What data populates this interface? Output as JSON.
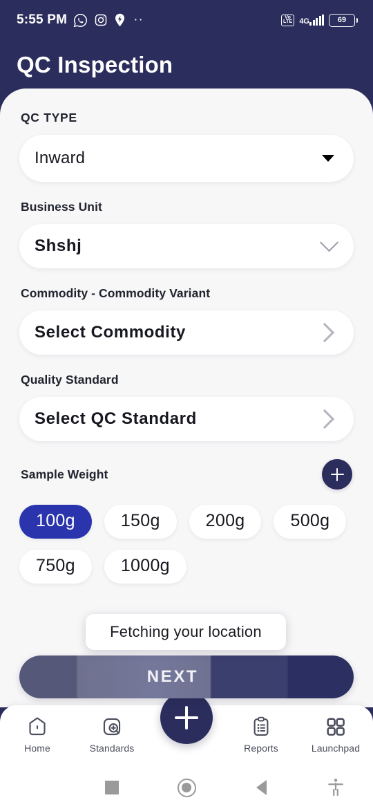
{
  "status_bar": {
    "time": "5:55 PM",
    "icons": [
      "whatsapp-icon",
      "instagram-icon",
      "location-pin-icon"
    ],
    "more_indicator": "··",
    "volte_top": "Vo",
    "volte_bottom": "LTE",
    "network": "4G",
    "battery_percent": "69"
  },
  "header": {
    "title": "QC Inspection",
    "background_color": "#2b2d5c"
  },
  "form": {
    "qc_type": {
      "label": "QC TYPE",
      "value": "Inward",
      "icon": "caret-down-icon"
    },
    "business_unit": {
      "label": "Business Unit",
      "value": "Shshj",
      "icon": "chevron-down-icon"
    },
    "commodity": {
      "label": "Commodity - Commodity Variant",
      "value": "Select Commodity",
      "icon": "chevron-right-icon"
    },
    "quality_standard": {
      "label": "Quality Standard",
      "value": "Select QC Standard",
      "icon": "chevron-right-icon"
    },
    "sample_weight": {
      "label": "Sample Weight",
      "add_icon": "plus-icon",
      "selected": "100g",
      "selected_color": "#2a34ac",
      "options": [
        "100g",
        "150g",
        "200g",
        "500g",
        "750g",
        "1000g"
      ]
    }
  },
  "toast": {
    "message": "Fetching your location"
  },
  "primary_action": {
    "label": "NEXT"
  },
  "bottom_nav": {
    "items": [
      {
        "label": "Home",
        "icon": "home-icon"
      },
      {
        "label": "Standards",
        "icon": "search-plus-square-icon"
      },
      {
        "label": "",
        "icon": "plus-fab-icon"
      },
      {
        "label": "Reports",
        "icon": "clipboard-list-icon"
      },
      {
        "label": "Launchpad",
        "icon": "grid-icon"
      }
    ]
  },
  "system_nav": {
    "recents": "square-recents-icon",
    "home": "circle-home-icon",
    "back": "triangle-back-icon",
    "accessibility": "accessibility-icon"
  }
}
